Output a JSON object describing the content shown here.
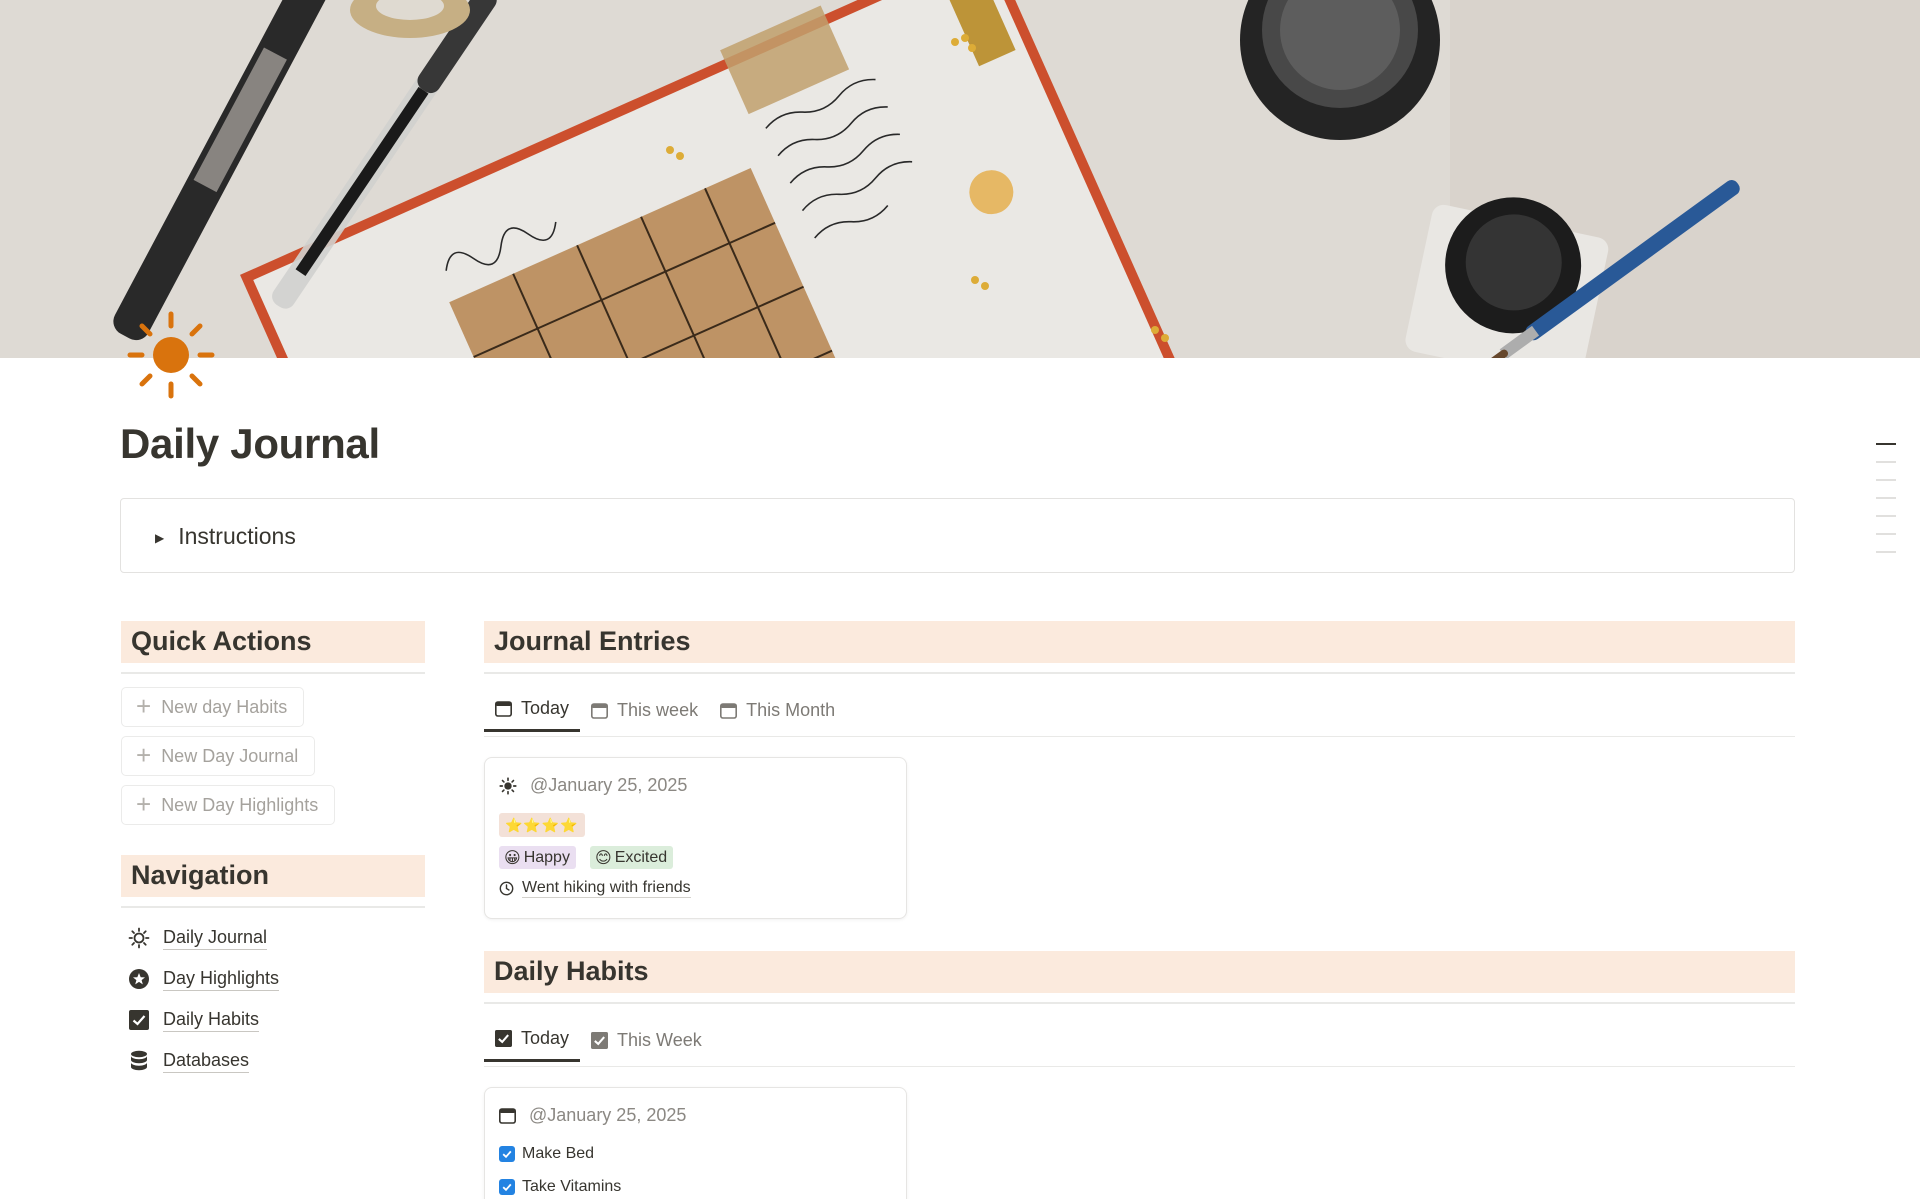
{
  "page": {
    "title": "Daily Journal",
    "icon": "sun-icon",
    "accent_color": "#d9730d",
    "header_bg_color": "#fbeadd"
  },
  "callout": {
    "toggle_label": "Instructions"
  },
  "quick_actions": {
    "heading": "Quick Actions",
    "buttons": [
      {
        "label": "New day Habits",
        "icon": "plus-icon"
      },
      {
        "label": "New Day Journal",
        "icon": "plus-icon"
      },
      {
        "label": "New Day Highlights",
        "icon": "plus-icon"
      }
    ]
  },
  "navigation": {
    "heading": "Navigation",
    "items": [
      {
        "label": "Daily Journal",
        "icon": "sun-icon"
      },
      {
        "label": "Day Highlights",
        "icon": "star-circle-icon"
      },
      {
        "label": "Daily Habits",
        "icon": "checkbox-icon"
      },
      {
        "label": "Databases",
        "icon": "database-icon"
      }
    ]
  },
  "journal_entries": {
    "heading": "Journal Entries",
    "tabs": [
      {
        "label": "Today",
        "icon": "calendar-icon",
        "active": true
      },
      {
        "label": "This week",
        "icon": "calendar-icon",
        "active": false
      },
      {
        "label": "This Month",
        "icon": "calendar-icon",
        "active": false
      }
    ],
    "cards": [
      {
        "date": "@January 25, 2025",
        "icon": "sun-icon",
        "rating": "⭐⭐⭐⭐",
        "tags": [
          {
            "emoji": "😀",
            "label": "Happy",
            "color": "#eadff1"
          },
          {
            "emoji": "😊",
            "label": "Excited",
            "color": "#dbeddb"
          }
        ],
        "highlight": "Went hiking with friends",
        "highlight_icon": "clock-icon"
      }
    ]
  },
  "daily_habits": {
    "heading": "Daily Habits",
    "tabs": [
      {
        "label": "Today",
        "icon": "checkbox-icon",
        "active": true
      },
      {
        "label": "This Week",
        "icon": "checkbox-icon",
        "active": false
      }
    ],
    "cards": [
      {
        "date": "@January 25, 2025",
        "icon": "calendar-icon",
        "habits": [
          {
            "label": "Make Bed",
            "checked": true
          },
          {
            "label": "Take Vitamins",
            "checked": true
          }
        ]
      }
    ]
  }
}
